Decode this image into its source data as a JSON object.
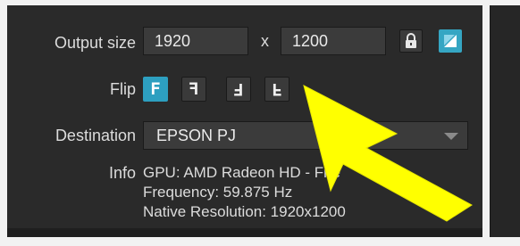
{
  "output_size": {
    "label": "Output size",
    "width": "1920",
    "separator": "x",
    "height": "1200",
    "lock_icon": "lock-icon",
    "aspect_icon": "aspect-ratio-icon",
    "accent_color": "#35a6c3"
  },
  "flip": {
    "label": "Flip",
    "buttons": [
      {
        "glyph": "F",
        "state": "active",
        "name": "flip-none"
      },
      {
        "glyph": "F",
        "state": "inactive",
        "name": "flip-horizontal"
      },
      {
        "glyph": "F",
        "state": "inactive",
        "name": "flip-both"
      },
      {
        "glyph": "F",
        "state": "inactive",
        "name": "flip-vertical"
      }
    ]
  },
  "destination": {
    "label": "Destination",
    "selected": "EPSON PJ",
    "arrow_icon": "chevron-down-icon"
  },
  "info": {
    "label": "Info",
    "lines": [
      "GPU: AMD Radeon HD - Fire",
      "Frequency: 59.875 Hz",
      "Native Resolution: 1920x1200"
    ]
  },
  "annotation": {
    "arrow_color": "#ffff00"
  }
}
